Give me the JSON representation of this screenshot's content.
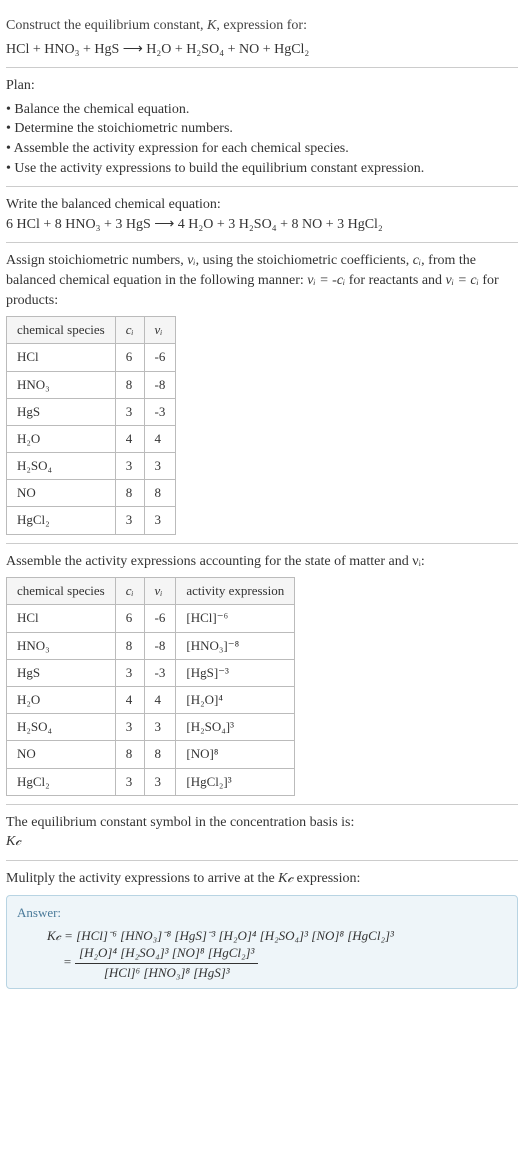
{
  "header": {
    "title_line1": "Construct the equilibrium constant, ",
    "title_k": "K",
    "title_line1_end": ", expression for:",
    "equation": "HCl + HNO₃ + HgS ⟶ H₂O + H₂SO₄ + NO + HgCl₂"
  },
  "plan": {
    "label": "Plan:",
    "items": [
      "• Balance the chemical equation.",
      "• Determine the stoichiometric numbers.",
      "• Assemble the activity expression for each chemical species.",
      "• Use the activity expressions to build the equilibrium constant expression."
    ]
  },
  "balanced": {
    "label": "Write the balanced chemical equation:",
    "equation": "6 HCl + 8 HNO₃ + 3 HgS ⟶ 4 H₂O + 3 H₂SO₄ + 8 NO + 3 HgCl₂"
  },
  "stoich": {
    "intro1": "Assign stoichiometric numbers, ",
    "nu": "νᵢ",
    "intro2": ", using the stoichiometric coefficients, ",
    "ci": "cᵢ",
    "intro3": ", from the balanced chemical equation in the following manner: ",
    "expr_reactants": "νᵢ = -cᵢ",
    "intro4": " for reactants and ",
    "expr_products": "νᵢ = cᵢ",
    "intro5": " for products:",
    "headers": {
      "species": "chemical species",
      "ci": "cᵢ",
      "nu": "νᵢ"
    },
    "rows": [
      {
        "species": "HCl",
        "ci": "6",
        "nu": "-6"
      },
      {
        "species": "HNO₃",
        "ci": "8",
        "nu": "-8"
      },
      {
        "species": "HgS",
        "ci": "3",
        "nu": "-3"
      },
      {
        "species": "H₂O",
        "ci": "4",
        "nu": "4"
      },
      {
        "species": "H₂SO₄",
        "ci": "3",
        "nu": "3"
      },
      {
        "species": "NO",
        "ci": "8",
        "nu": "8"
      },
      {
        "species": "HgCl₂",
        "ci": "3",
        "nu": "3"
      }
    ]
  },
  "activity": {
    "intro": "Assemble the activity expressions accounting for the state of matter and νᵢ:",
    "headers": {
      "species": "chemical species",
      "ci": "cᵢ",
      "nu": "νᵢ",
      "expr": "activity expression"
    },
    "rows": [
      {
        "species": "HCl",
        "ci": "6",
        "nu": "-6",
        "expr": "[HCl]⁻⁶"
      },
      {
        "species": "HNO₃",
        "ci": "8",
        "nu": "-8",
        "expr": "[HNO₃]⁻⁸"
      },
      {
        "species": "HgS",
        "ci": "3",
        "nu": "-3",
        "expr": "[HgS]⁻³"
      },
      {
        "species": "H₂O",
        "ci": "4",
        "nu": "4",
        "expr": "[H₂O]⁴"
      },
      {
        "species": "H₂SO₄",
        "ci": "3",
        "nu": "3",
        "expr": "[H₂SO₄]³"
      },
      {
        "species": "NO",
        "ci": "8",
        "nu": "8",
        "expr": "[NO]⁸"
      },
      {
        "species": "HgCl₂",
        "ci": "3",
        "nu": "3",
        "expr": "[HgCl₂]³"
      }
    ]
  },
  "symbol": {
    "line": "The equilibrium constant symbol in the concentration basis is:",
    "kc": "K𝒸"
  },
  "multiply": {
    "line1": "Mulitply the activity expressions to arrive at the ",
    "kc": "K𝒸",
    "line2": " expression:"
  },
  "answer": {
    "label": "Answer:",
    "kc_eq": "K𝒸 = ",
    "flat_expr": "[HCl]⁻⁶ [HNO₃]⁻⁸ [HgS]⁻³ [H₂O]⁴ [H₂SO₄]³ [NO]⁸ [HgCl₂]³",
    "eq2": " = ",
    "frac_num": "[H₂O]⁴ [H₂SO₄]³ [NO]⁸ [HgCl₂]³",
    "frac_den": "[HCl]⁶ [HNO₃]⁸ [HgS]³"
  },
  "chart_data": {
    "type": "table",
    "tables": [
      {
        "title": "stoichiometric numbers",
        "columns": [
          "chemical species",
          "c_i",
          "ν_i"
        ],
        "rows": [
          [
            "HCl",
            6,
            -6
          ],
          [
            "HNO3",
            8,
            -8
          ],
          [
            "HgS",
            3,
            -3
          ],
          [
            "H2O",
            4,
            4
          ],
          [
            "H2SO4",
            3,
            3
          ],
          [
            "NO",
            8,
            8
          ],
          [
            "HgCl2",
            3,
            3
          ]
        ]
      },
      {
        "title": "activity expressions",
        "columns": [
          "chemical species",
          "c_i",
          "ν_i",
          "activity expression"
        ],
        "rows": [
          [
            "HCl",
            6,
            -6,
            "[HCl]^-6"
          ],
          [
            "HNO3",
            8,
            -8,
            "[HNO3]^-8"
          ],
          [
            "HgS",
            3,
            -3,
            "[HgS]^-3"
          ],
          [
            "H2O",
            4,
            4,
            "[H2O]^4"
          ],
          [
            "H2SO4",
            3,
            3,
            "[H2SO4]^3"
          ],
          [
            "NO",
            8,
            8,
            "[NO]^8"
          ],
          [
            "HgCl2",
            3,
            3,
            "[HgCl2]^3"
          ]
        ]
      }
    ]
  }
}
